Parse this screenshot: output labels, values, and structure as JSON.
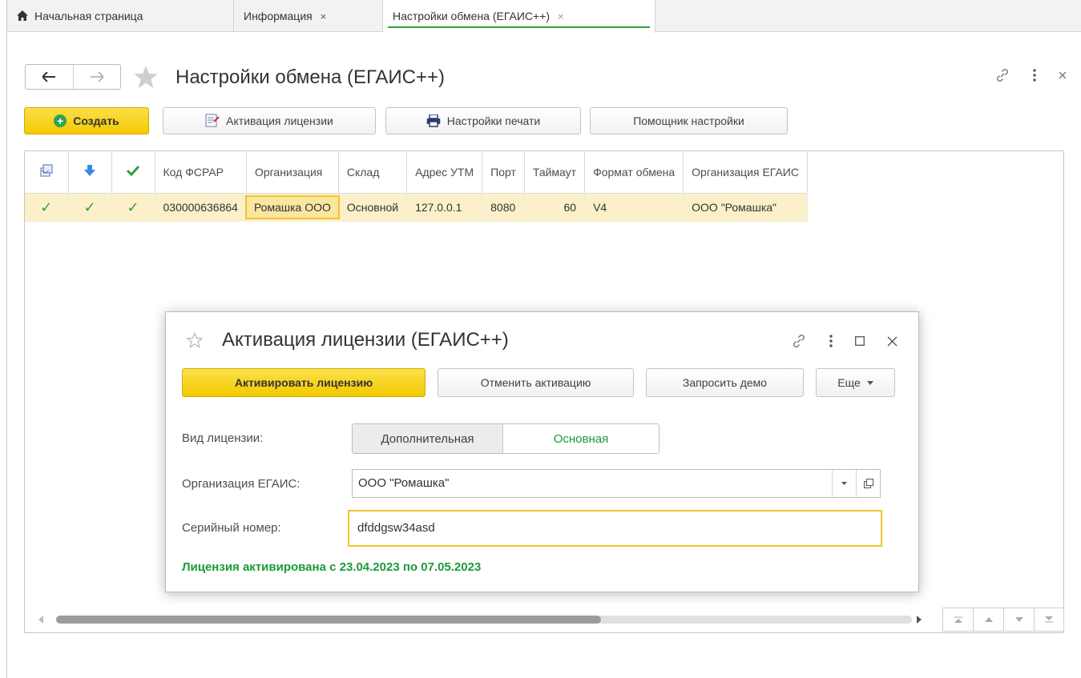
{
  "tabs": [
    {
      "label": "Начальная страница"
    },
    {
      "label": "Информация",
      "close": "×"
    },
    {
      "label": "Настройки обмена (ЕГАИС++)",
      "close": "×"
    }
  ],
  "page": {
    "title": "Настройки обмена (ЕГАИС++)"
  },
  "toolbar": {
    "create_label": "Создать",
    "activate_license_label": "Активация лицензии",
    "print_settings_label": "Настройки печати",
    "setup_helper_label": "Помощник настройки"
  },
  "table": {
    "columns": [
      "Код ФСРАР",
      "Организация",
      "Склад",
      "Адрес УТМ",
      "Порт",
      "Таймаут",
      "Формат обмена",
      "Организация ЕГАИС"
    ],
    "rows": [
      {
        "check1": "✓",
        "check2": "✓",
        "check3": "✓",
        "fsrar": "030000636864",
        "org": "Ромашка ООО",
        "warehouse": "Основной",
        "utm": "127.0.0.1",
        "port": "8080",
        "timeout": "60",
        "format": "V4",
        "egais_org": "ООО \"Ромашка\""
      }
    ]
  },
  "dialog": {
    "title": "Активация лицензии (ЕГАИС++)",
    "activate_label": "Активировать лицензию",
    "cancel_label": "Отменить активацию",
    "demo_label": "Запросить демо",
    "more_label": "Еще",
    "license_type_label": "Вид лицензии:",
    "license_types": [
      "Дополнительная",
      "Основная"
    ],
    "selected_license_type": "Основная",
    "egais_org_label": "Организация ЕГАИС:",
    "egais_org_value": "ООО \"Ромашка\"",
    "serial_label": "Серийный номер:",
    "serial_value": "dfddgsw34asd",
    "status_text": "Лицензия активирована с 23.04.2023 по 07.05.2023"
  },
  "scrollbar": {
    "position": 0.63
  },
  "colors": {
    "accent_green": "#1a9b38",
    "accent_yellow": "#f3c900",
    "row_highlight": "#fbf0c9"
  }
}
